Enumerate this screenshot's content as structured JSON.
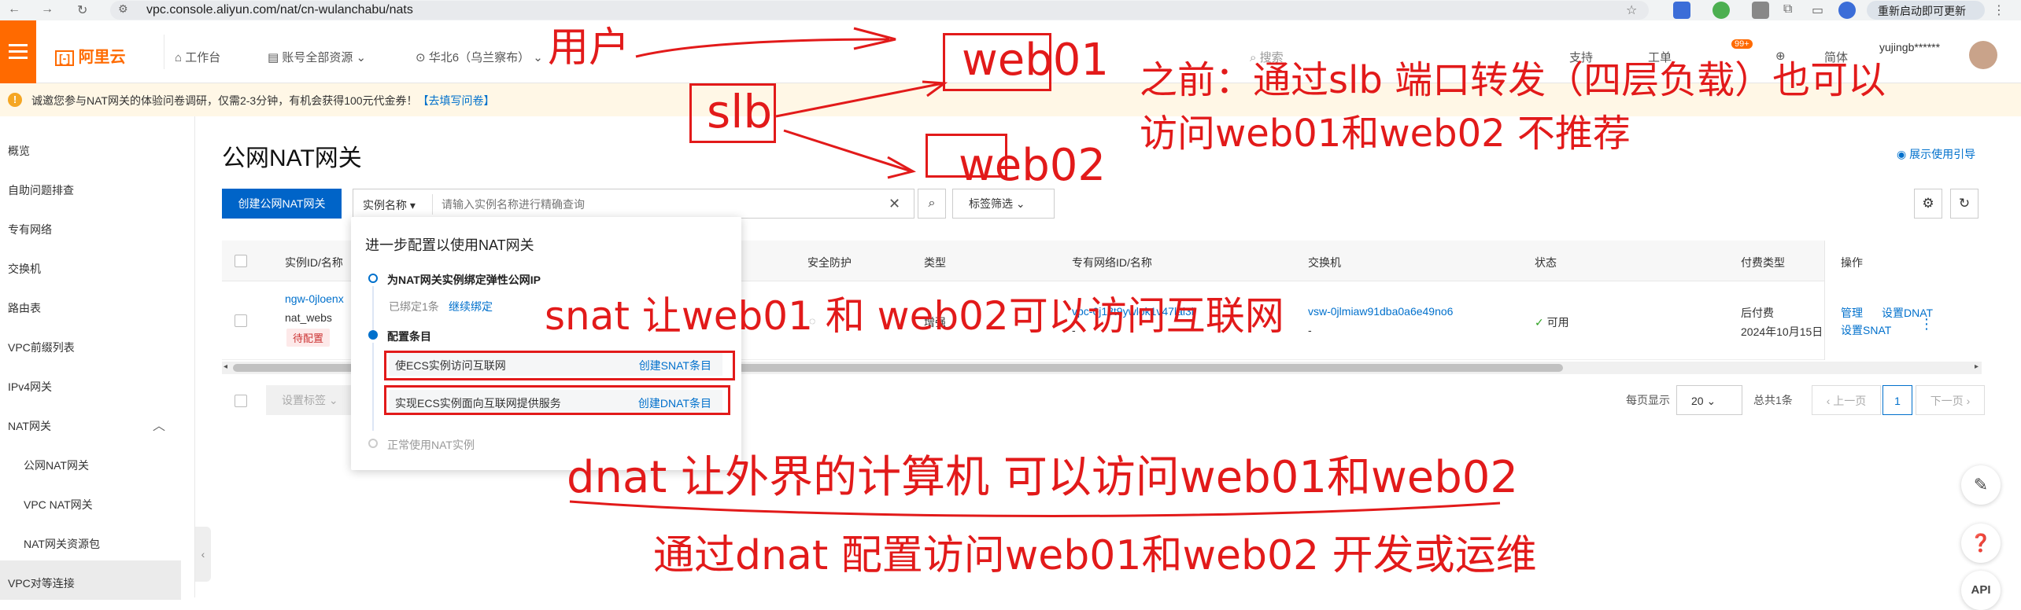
{
  "browser": {
    "url": "vpc.console.aliyun.com/nat/cn-wulanchabu/nats",
    "restart_label": "重新启动即可更新"
  },
  "header": {
    "logo": "阿里云",
    "workbench": "工作台",
    "account_resources": "账号全部资源",
    "region": "华北6（乌兰察布）",
    "search_placeholder": "搜索",
    "support": "支持",
    "work_order": "工单",
    "badge": "99+",
    "lang": "简体",
    "user": "yujingb******"
  },
  "notice": {
    "text": "诚邀您参与NAT网关的体验问卷调研，仅需2-3分钟，有机会获得100元代金券！",
    "link": "【去填写问卷】"
  },
  "sidebar": {
    "items": [
      "概览",
      "自助问题排查",
      "专有网络",
      "交换机",
      "路由表",
      "VPC前缀列表",
      "IPv4网关",
      "NAT网关",
      "公网NAT网关",
      "VPC NAT网关",
      "NAT网关资源包",
      "VPC对等连接"
    ]
  },
  "main": {
    "title": "公网NAT网关",
    "guide_link": "展示使用引导",
    "create_button": "创建公网NAT网关",
    "filter_select": "实例名称",
    "search_placeholder": "请输入实例名称进行精确查询",
    "tag_filter": "标签筛选"
  },
  "table": {
    "columns": [
      "实例ID/名称",
      "安全防护",
      "类型",
      "专有网络ID/名称",
      "交换机",
      "状态",
      "付费类型",
      "操作"
    ],
    "row": {
      "id": "ngw-0jloenx",
      "name": "nat_webs",
      "badge": "待配置",
      "type": "增强",
      "vpc": "vpc-0j18t9ywlok1v47lal3l",
      "vswitch": "vsw-0jlmiaw91dba0a6e49no6",
      "status": "可用",
      "pay_type": "后付费",
      "pay_date": "2024年10月15日",
      "ops": [
        "管理",
        "设置DNAT",
        "设置SNAT"
      ]
    }
  },
  "footer": {
    "batch_tag": "设置标签",
    "page_size_label": "每页显示",
    "page_size": "20",
    "total": "总共1条",
    "prev": "上一页",
    "page": "1",
    "next": "下一页"
  },
  "popup": {
    "title": "进一步配置以使用NAT网关",
    "step1_title": "为NAT网关实例绑定弹性公网IP",
    "step1_bound": "已绑定1条",
    "step1_link": "继续绑定",
    "step2_title": "配置条目",
    "item1_label": "使ECS实例访问互联网",
    "item1_action": "创建SNAT条目",
    "item2_label": "实现ECS实例面向互联网提供服务",
    "item2_action": "创建DNAT条目",
    "step3_title": "正常使用NAT实例"
  },
  "annotations": {
    "user": "用户",
    "web01": "web01",
    "slb": "slb",
    "web02": "web02",
    "note_line1": "之前：通过slb 端口转发（四层负载）也可以",
    "note_line2": "访问web01和web02    不推荐",
    "snat": "snat  让web01  和  web02可以访问互联网",
    "dnat": "dnat 让外界的计算机 可以访问web01和web02",
    "dnat_note": "通过dnat 配置访问web01和web02    开发或运维"
  },
  "colors": {
    "brand": "#ff6a00",
    "primary": "#0064c8",
    "link": "#0070cc",
    "annotation": "#e21a1a"
  }
}
